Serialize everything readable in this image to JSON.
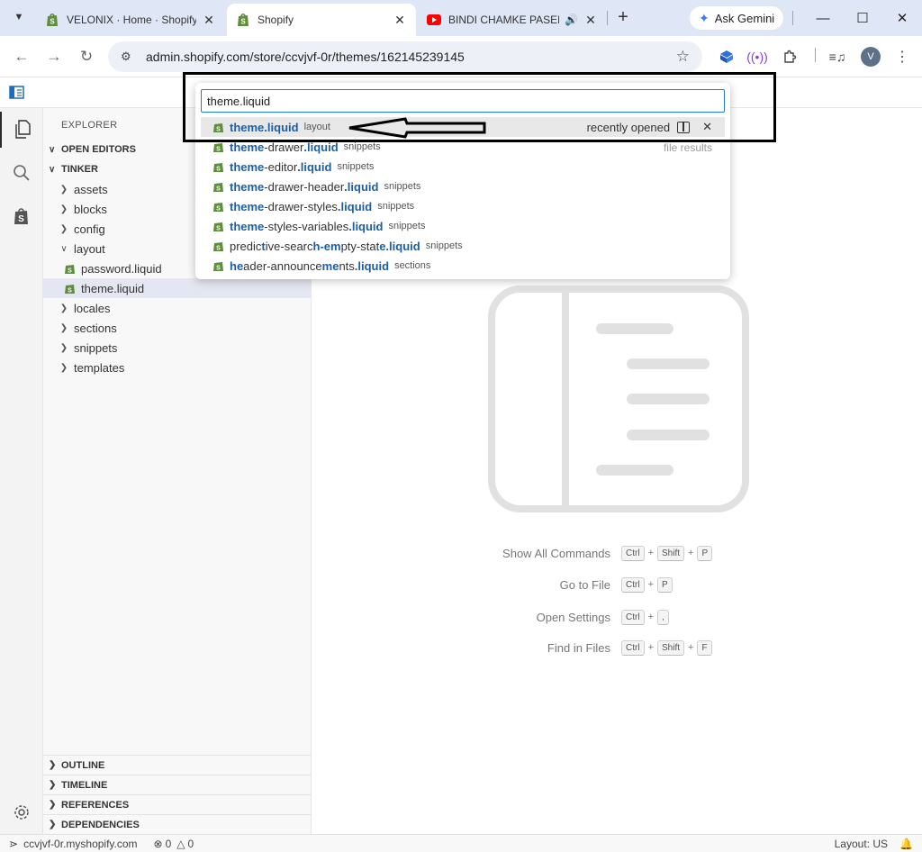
{
  "browser": {
    "tabs": [
      {
        "title": "VELONIX · Home · Shopify",
        "icon": "shopify-icon",
        "active": false
      },
      {
        "title": "Shopify",
        "icon": "shopify-icon",
        "active": true
      },
      {
        "title": "BINDI CHAMKE PASEENA",
        "icon": "youtube-icon",
        "active": false,
        "audio": true
      }
    ],
    "gemini_label": "Ask Gemini",
    "url": "admin.shopify.com/store/ccvjvf-0r/themes/162145239145",
    "profile_initial": "V"
  },
  "quick_open": {
    "query": "theme.liquid",
    "items": [
      {
        "parts": [
          {
            "t": "theme.liquid",
            "h": true
          }
        ],
        "desc": "layout"
      },
      {
        "parts": [
          {
            "t": "theme",
            "h": true
          },
          {
            "t": "-drawer",
            "h": false
          },
          {
            "t": ".liquid",
            "h": true
          }
        ],
        "desc": "snippets"
      },
      {
        "parts": [
          {
            "t": "theme",
            "h": true
          },
          {
            "t": "-editor",
            "h": false
          },
          {
            "t": ".liquid",
            "h": true
          }
        ],
        "desc": "snippets"
      },
      {
        "parts": [
          {
            "t": "theme",
            "h": true
          },
          {
            "t": "-drawer-header",
            "h": false
          },
          {
            "t": ".liquid",
            "h": true
          }
        ],
        "desc": "snippets"
      },
      {
        "parts": [
          {
            "t": "theme",
            "h": true
          },
          {
            "t": "-drawer-styles",
            "h": false
          },
          {
            "t": ".liquid",
            "h": true
          }
        ],
        "desc": "snippets"
      },
      {
        "parts": [
          {
            "t": "theme",
            "h": true
          },
          {
            "t": "-styles-variables",
            "h": false
          },
          {
            "t": ".liquid",
            "h": true
          }
        ],
        "desc": "snippets"
      },
      {
        "parts": [
          {
            "t": "predic",
            "h": false
          },
          {
            "t": "t",
            "h": true
          },
          {
            "t": "ive-searc",
            "h": false
          },
          {
            "t": "h-em",
            "h": true
          },
          {
            "t": "pty-stat",
            "h": false
          },
          {
            "t": "e.liquid",
            "h": true
          }
        ],
        "desc": "snippets"
      },
      {
        "parts": [
          {
            "t": "he",
            "h": true
          },
          {
            "t": "ader-announce",
            "h": false
          },
          {
            "t": "me",
            "h": true
          },
          {
            "t": "nts",
            "h": false
          },
          {
            "t": ".liquid",
            "h": true
          }
        ],
        "desc": "sections"
      }
    ],
    "recently_opened_label": "recently opened",
    "file_results_label": "file results"
  },
  "explorer": {
    "title": "EXPLORER",
    "open_editors": "OPEN EDITORS",
    "workspace": "TINKER",
    "tree": [
      {
        "label": "assets",
        "type": "folder",
        "expanded": false
      },
      {
        "label": "blocks",
        "type": "folder",
        "expanded": false
      },
      {
        "label": "config",
        "type": "folder",
        "expanded": false
      },
      {
        "label": "layout",
        "type": "folder",
        "expanded": true
      },
      {
        "label": "password.liquid",
        "type": "file"
      },
      {
        "label": "theme.liquid",
        "type": "file",
        "selected": true
      },
      {
        "label": "locales",
        "type": "folder",
        "expanded": false
      },
      {
        "label": "sections",
        "type": "folder",
        "expanded": false
      },
      {
        "label": "snippets",
        "type": "folder",
        "expanded": false
      },
      {
        "label": "templates",
        "type": "folder",
        "expanded": false
      }
    ],
    "bottom_sections": [
      "OUTLINE",
      "TIMELINE",
      "REFERENCES",
      "DEPENDENCIES"
    ]
  },
  "shortcuts": [
    {
      "label": "Show All Commands",
      "keys": [
        "Ctrl",
        "Shift",
        "P"
      ]
    },
    {
      "label": "Go to File",
      "keys": [
        "Ctrl",
        "P"
      ]
    },
    {
      "label": "Open Settings",
      "keys": [
        "Ctrl",
        ","
      ]
    },
    {
      "label": "Find in Files",
      "keys": [
        "Ctrl",
        "Shift",
        "F"
      ]
    }
  ],
  "status": {
    "remote": "ccvjvf-0r.myshopify.com",
    "errors": "0",
    "warnings": "0",
    "layout": "Layout: US"
  },
  "colors": {
    "accent": "#1f7ad9",
    "highlight": "#1a5fa8",
    "selection": "#e4e6f1"
  }
}
